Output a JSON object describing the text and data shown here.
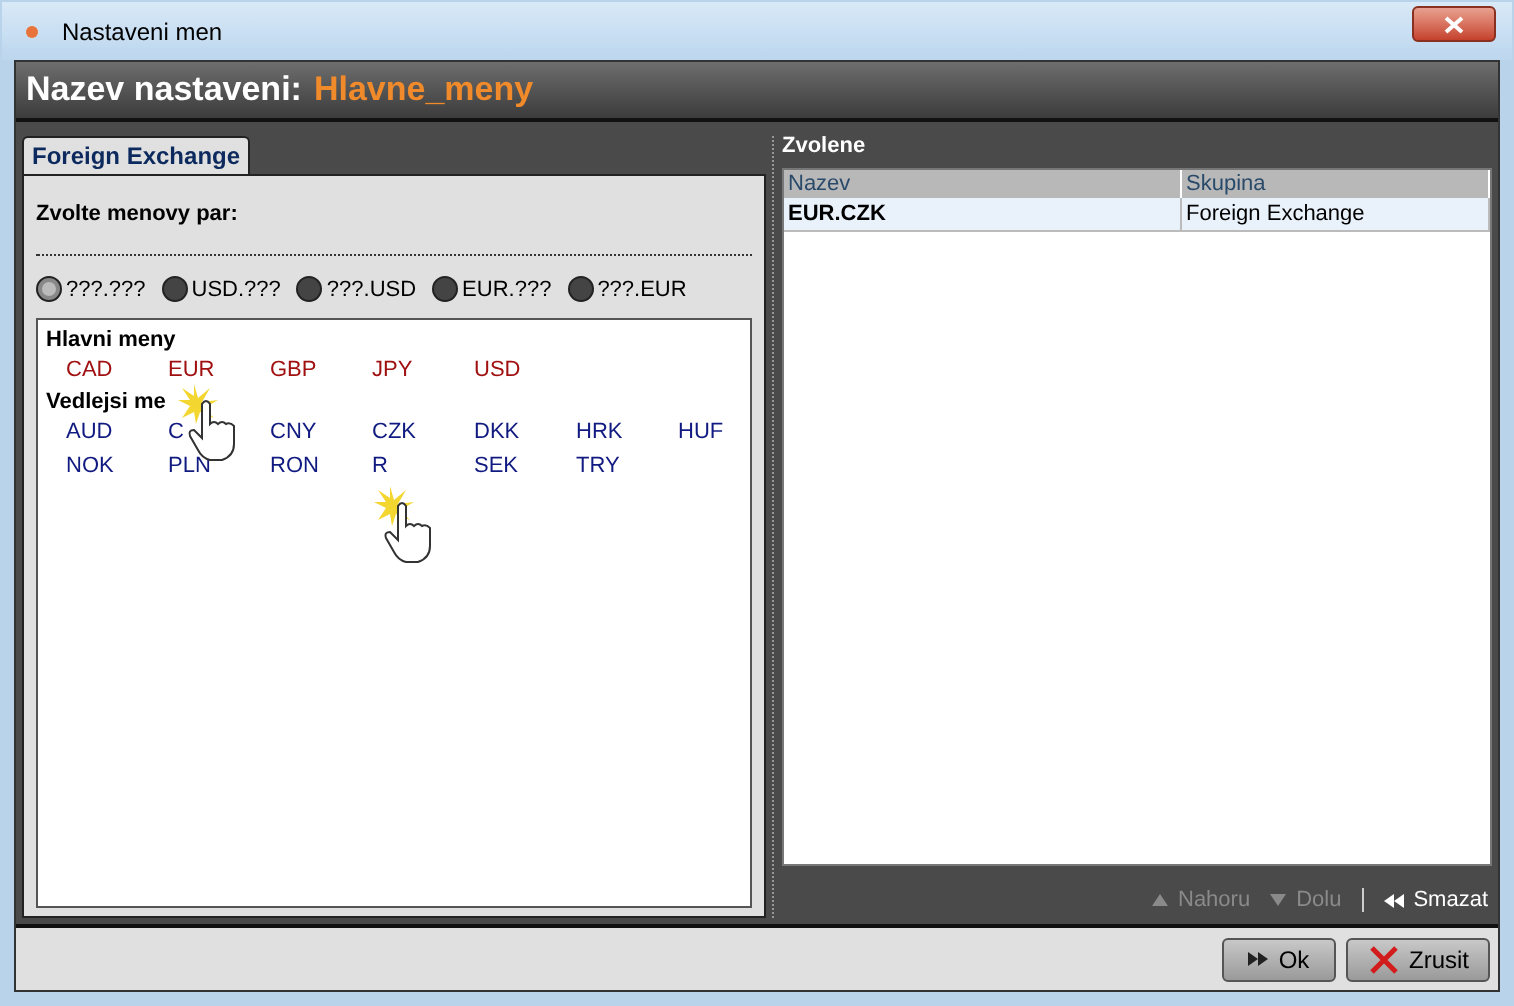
{
  "window": {
    "title": "Nastaveni men"
  },
  "header": {
    "label": "Nazev nastaveni:",
    "value": "Hlavne_meny"
  },
  "tabs": [
    {
      "label": "Foreign Exchange",
      "selected": true
    }
  ],
  "prompt": "Zvolte menovy par:",
  "pair_filters": [
    {
      "label": "???.???",
      "selected": true
    },
    {
      "label": "USD.???",
      "selected": false
    },
    {
      "label": "???.USD",
      "selected": false
    },
    {
      "label": "EUR.???",
      "selected": false
    },
    {
      "label": "???.EUR",
      "selected": false
    }
  ],
  "currency_groups": [
    {
      "title": "Hlavni meny",
      "kind": "major",
      "currencies": [
        "CAD",
        "EUR",
        "GBP",
        "JPY",
        "USD"
      ]
    },
    {
      "title": "Vedlejsi me",
      "kind": "minor",
      "currencies": [
        "AUD",
        "C",
        "CNY",
        "CZK",
        "DKK",
        "HRK",
        "HUF",
        "NOK",
        "PLN",
        "RON",
        "R",
        "SEK",
        "TRY"
      ]
    }
  ],
  "selected_panel": {
    "title": "Zvolene",
    "columns": [
      "Nazev",
      "Skupina"
    ],
    "rows": [
      {
        "cells": [
          "EUR.CZK",
          "Foreign Exchange"
        ],
        "selected": true
      }
    ]
  },
  "list_actions": [
    {
      "label": "Nahoru",
      "kind": "up",
      "disabled": true
    },
    {
      "label": "Dolu",
      "kind": "down",
      "disabled": true
    },
    {
      "label": "Smazat",
      "kind": "delete",
      "disabled": false
    }
  ],
  "buttons": [
    {
      "label": "Ok",
      "kind": "ok"
    },
    {
      "label": "Zrusit",
      "kind": "cancel"
    }
  ]
}
